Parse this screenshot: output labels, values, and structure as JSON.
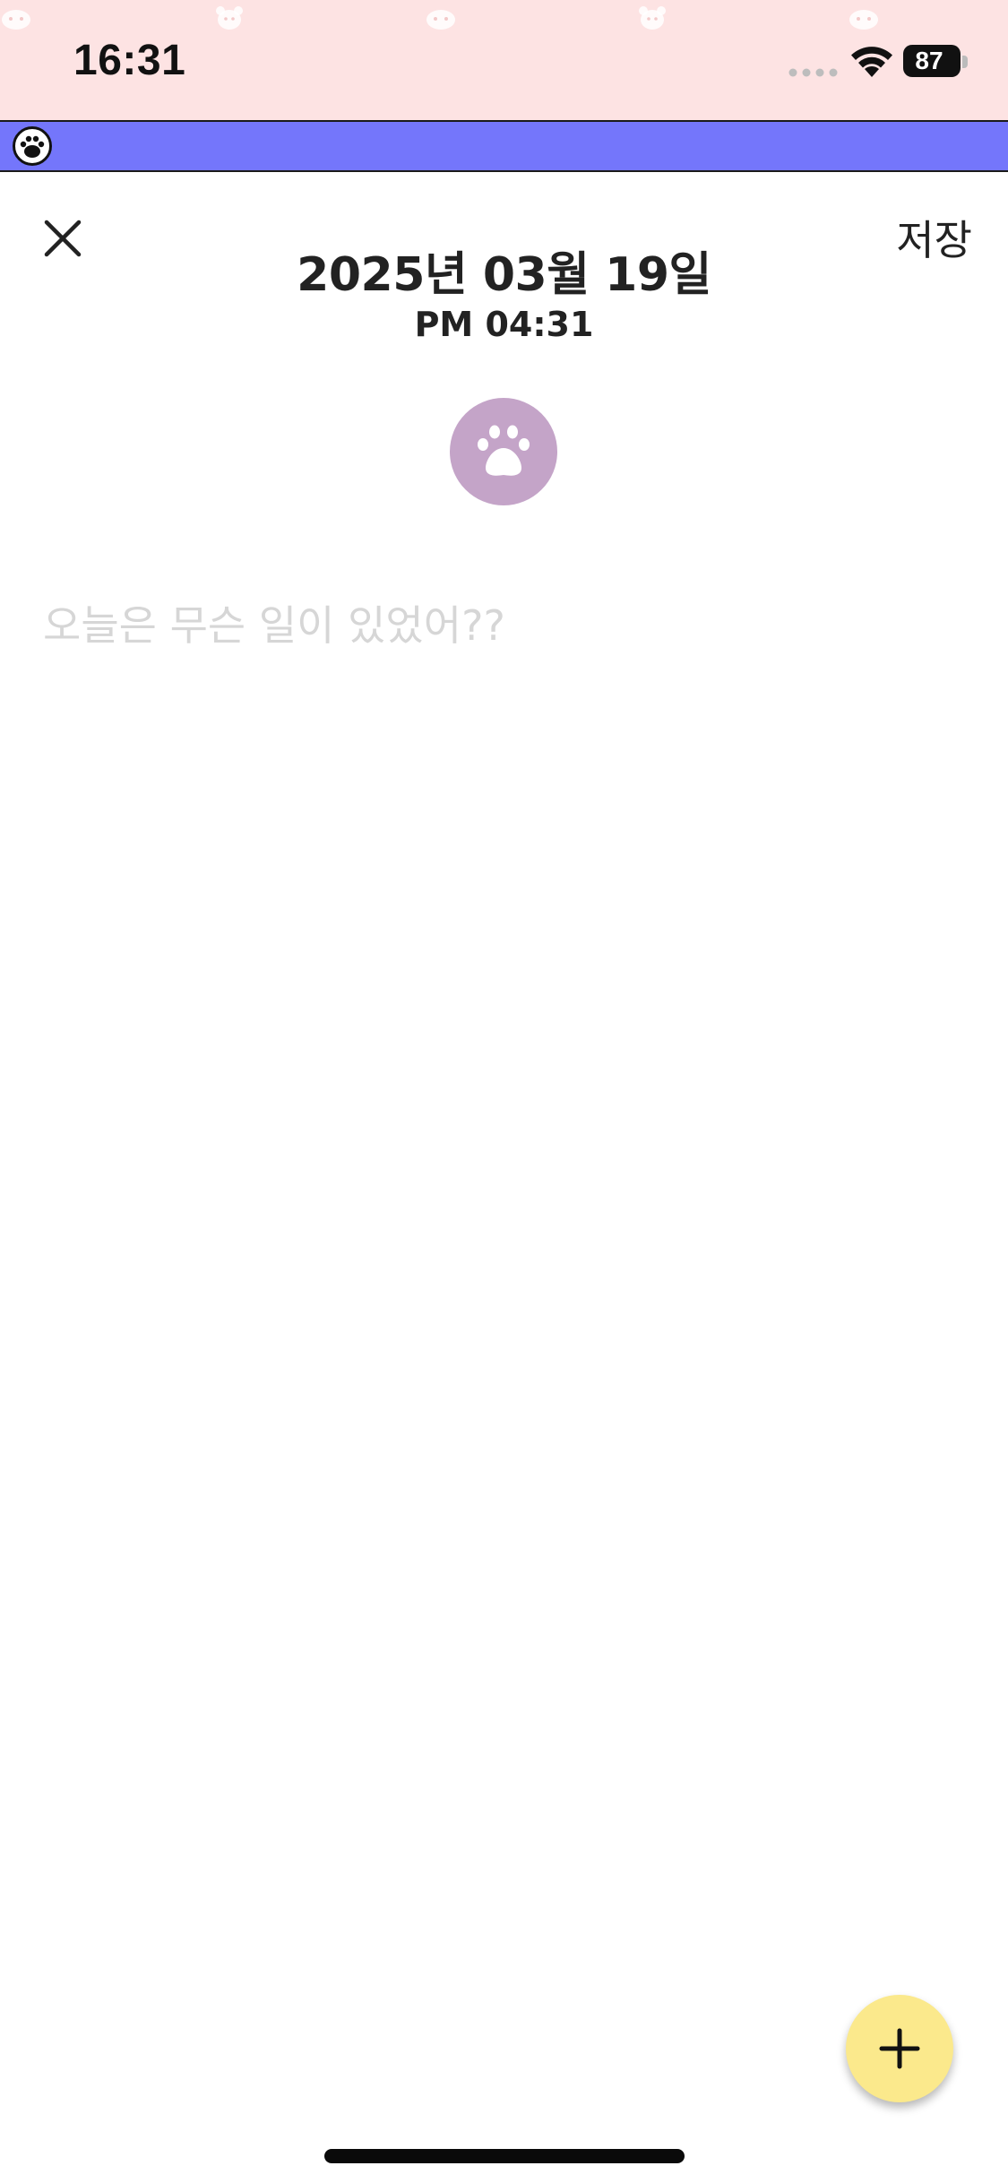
{
  "status_bar": {
    "time": "16:31",
    "battery_level": "87",
    "background_color": "#fde3e3"
  },
  "banner": {
    "color": "#7476fb",
    "icon": "paw-icon"
  },
  "header": {
    "close_icon": "close-icon",
    "save_label": "저장",
    "date": "2025년 03월 19일",
    "time": "PM 04:31"
  },
  "mood": {
    "icon": "paw-icon",
    "color": "#c4a4c8"
  },
  "editor": {
    "placeholder": "오늘은 무슨 일이 있었어??",
    "value": ""
  },
  "fab": {
    "icon": "plus-icon",
    "color": "#fbe98c"
  }
}
